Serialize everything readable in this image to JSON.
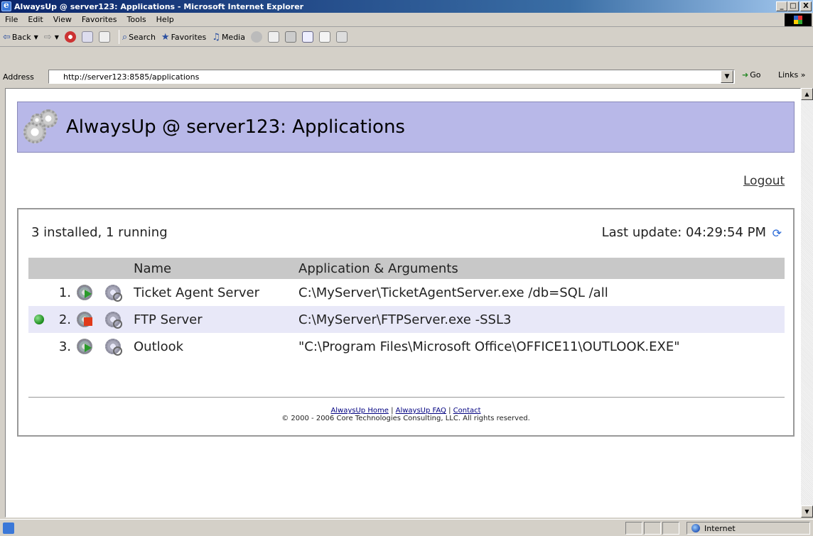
{
  "window": {
    "title": "AlwaysUp @ server123: Applications - Microsoft Internet Explorer",
    "min": "_",
    "max": "□",
    "close": "X"
  },
  "menu": [
    "File",
    "Edit",
    "View",
    "Favorites",
    "Tools",
    "Help"
  ],
  "toolbar": {
    "back": "Back",
    "search": "Search",
    "favorites": "Favorites",
    "media": "Media"
  },
  "address": {
    "label": "Address",
    "url": "http://server123:8585/applications",
    "go": "Go",
    "links": "Links »"
  },
  "page": {
    "title": "AlwaysUp @ server123: Applications",
    "logout": "Logout",
    "status": "3 installed, 1 running",
    "last_update": "Last update: 04:29:54 PM",
    "columns": {
      "name": "Name",
      "app": "Application & Arguments"
    },
    "rows": [
      {
        "num": "1.",
        "name": "Ticket Agent Server",
        "app": "C:\\MyServer\\TicketAgentServer.exe /db=SQL /all",
        "running": false
      },
      {
        "num": "2.",
        "name": "FTP Server",
        "app": "C:\\MyServer\\FTPServer.exe -SSL3",
        "running": true
      },
      {
        "num": "3.",
        "name": "Outlook",
        "app": "\"C:\\Program Files\\Microsoft Office\\OFFICE11\\OUTLOOK.EXE\"",
        "running": false
      }
    ],
    "footer": {
      "home": "AlwaysUp Home",
      "faq": "AlwaysUp FAQ",
      "contact": "Contact",
      "sep": "|",
      "copyright": "© 2000 - 2006 Core Technologies Consulting, LLC. All rights reserved."
    }
  },
  "statusbar": {
    "zone": "Internet"
  },
  "colors": {
    "header_bg": "#b8b8e8",
    "running": "#1a8a1a",
    "stopped_badge": "#e03a1a",
    "link": "#000080"
  }
}
